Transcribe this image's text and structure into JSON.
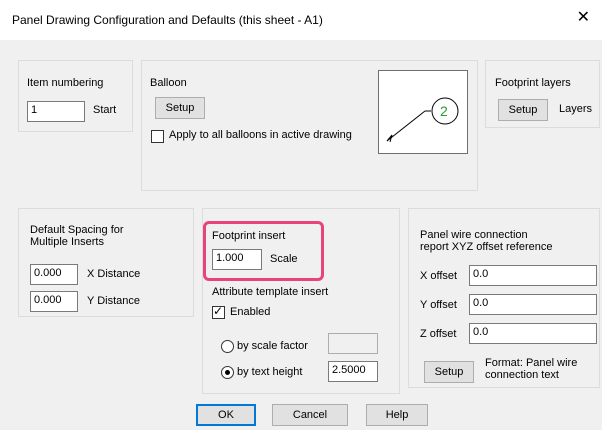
{
  "window": {
    "title": "Panel Drawing Configuration and Defaults (this sheet - A1)",
    "close_glyph": "✕"
  },
  "item_numbering": {
    "label": "Item numbering",
    "value": "1",
    "suffix": "Start"
  },
  "balloon": {
    "label": "Balloon",
    "setup_label": "Setup",
    "apply_label": "Apply to all balloons in active drawing",
    "apply_checked": false,
    "preview_number": "2"
  },
  "footprint_layers": {
    "label": "Footprint layers",
    "setup_label": "Setup",
    "suffix": "Layers"
  },
  "default_spacing": {
    "label_line1": "Default Spacing for",
    "label_line2": "Multiple Inserts",
    "x_value": "0.000",
    "x_label": "X Distance",
    "y_value": "0.000",
    "y_label": "Y Distance"
  },
  "footprint_insert": {
    "label": "Footprint insert",
    "scale_value": "1.000",
    "scale_label": "Scale"
  },
  "attribute_template": {
    "label": "Attribute template insert",
    "enabled_label": "Enabled",
    "enabled_checked": true,
    "by_scale_factor_label": "by scale factor",
    "by_scale_factor_value": "",
    "by_text_height_label": "by text height",
    "by_text_height_value": "2.5000",
    "selected_option": "by text height"
  },
  "panel_wire": {
    "label_line1": "Panel wire connection",
    "label_line2": "report XYZ offset reference",
    "x_label": "X offset",
    "x_value": "0.0",
    "y_label": "Y offset",
    "y_value": "0.0",
    "z_label": "Z offset",
    "z_value": "0.0",
    "setup_label": "Setup",
    "format_line1": "Format: Panel wire",
    "format_line2": "connection text"
  },
  "buttons": {
    "ok": "OK",
    "cancel": "Cancel",
    "help": "Help"
  },
  "colors": {
    "highlight": "#e8437a",
    "preview_arrow": "#000000",
    "balloon_circle": "#2a9a2a"
  }
}
